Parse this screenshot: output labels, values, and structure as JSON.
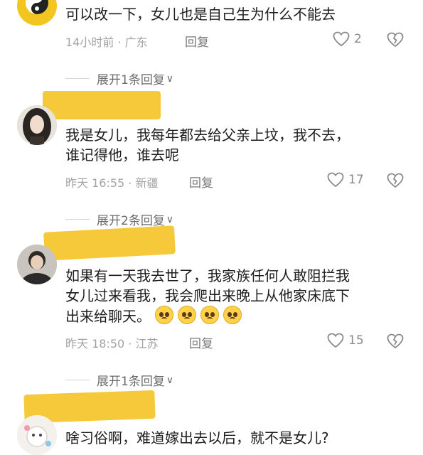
{
  "comments": [
    {
      "avatar": "yin-yang-logo-avatar",
      "text_lines": [
        "可以改一下，女儿也是自己生为什么不能去"
      ],
      "time": "14小时前",
      "location": "广东",
      "reply_label": "回复",
      "like_count": "2",
      "expand_label": "展开1条回复"
    },
    {
      "avatar": "woman-avatar",
      "text_lines": [
        "我是女儿，我每年都去给父亲上坟，我不去，",
        "谁记得他，谁去呢"
      ],
      "time": "昨天 16:55",
      "location": "新疆",
      "reply_label": "回复",
      "like_count": "17",
      "expand_label": "展开2条回复"
    },
    {
      "avatar": "man-avatar",
      "text_lines": [
        "如果有一天我去世了，我家族任何人敢阻拦我",
        "女儿过来看我，我会爬出来晚上从他家床底下",
        "出来给聊天。"
      ],
      "emoji_count": 4,
      "emoji": "pleading-face-emoji",
      "time": "昨天 18:50",
      "location": "江苏",
      "reply_label": "回复",
      "like_count": "15",
      "expand_label": "展开1条回复"
    },
    {
      "avatar": "cartoon-avatar",
      "text_lines": [
        "啥习俗啊，难道嫁出去以后，就不是女儿?"
      ]
    }
  ],
  "separator": "·",
  "colors": {
    "name_mask": "#f6c93a",
    "meta_text": "#a3a3a3",
    "icon": "#8a8a8a"
  }
}
